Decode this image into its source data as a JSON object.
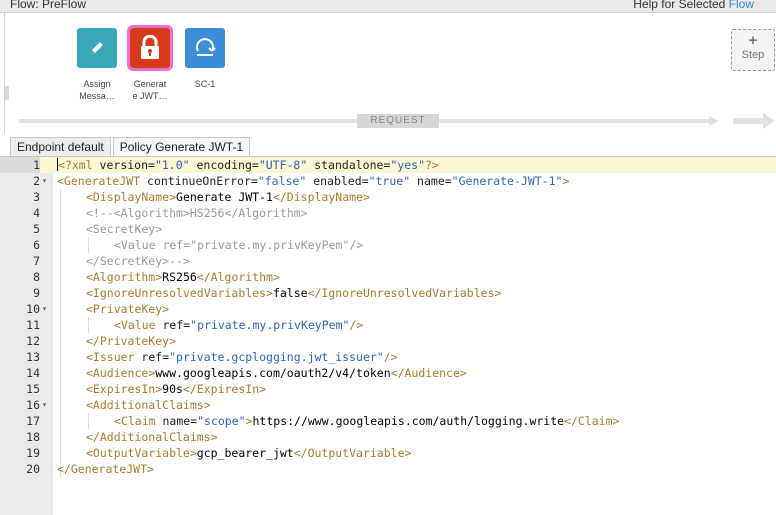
{
  "header": {
    "flow_title": "Flow: PreFlow",
    "help_text": "Help for Selected",
    "help_link": "Flow"
  },
  "policies": [
    {
      "line1": "Assign",
      "line2": "Messa…",
      "icon": "pencil-icon",
      "color": "#36a8b6"
    },
    {
      "line1": "Generat",
      "line2": "e JWT…",
      "icon": "lock-icon",
      "color": "#d83a1d",
      "selected": true
    },
    {
      "line1": "SC-1",
      "line2": "",
      "icon": "refresh-icon",
      "color": "#3a8ed8"
    }
  ],
  "step_button": {
    "plus": "+",
    "label": "Step"
  },
  "flow_label": "REQUEST",
  "tabs": [
    {
      "label": "Endpoint default"
    },
    {
      "label": "Policy Generate JWT-1",
      "active": true
    }
  ],
  "editor": {
    "line_numbers": [
      "1",
      "2",
      "3",
      "4",
      "5",
      "6",
      "7",
      "8",
      "9",
      "10",
      "11",
      "12",
      "13",
      "14",
      "15",
      "16",
      "17",
      "18",
      "19",
      "20"
    ],
    "tokens": {
      "l1": [
        "<?xml",
        " version=",
        "\"1.0\"",
        " encoding=",
        "\"UTF-8\"",
        " standalone=",
        "\"yes\"",
        "?>"
      ],
      "l2": [
        "<GenerateJWT",
        " continueOnError=",
        "\"false\"",
        " enabled=",
        "\"true\"",
        " name=",
        "\"Generate-JWT-1\"",
        ">"
      ],
      "l3": [
        "<DisplayName>",
        "Generate JWT-1",
        "</DisplayName>"
      ],
      "l4": [
        "<!--<Algorithm>HS256</Algorithm>"
      ],
      "l5": [
        "<SecretKey>"
      ],
      "l6": [
        "<Value ref=\"private.my.privKeyPem\"/>"
      ],
      "l7": [
        "</SecretKey>-->"
      ],
      "l8": [
        "<Algorithm>",
        "RS256",
        "</Algorithm>"
      ],
      "l9": [
        "<IgnoreUnresolvedVariables>",
        "false",
        "</IgnoreUnresolvedVariables>"
      ],
      "l10": [
        "<PrivateKey>"
      ],
      "l11": [
        "<Value",
        " ref=",
        "\"private.my.privKeyPem\"",
        "/>"
      ],
      "l12": [
        "</PrivateKey>"
      ],
      "l13": [
        "<Issuer",
        " ref=",
        "\"private.gcplogging.jwt_issuer\"",
        "/>"
      ],
      "l14": [
        "<Audience>",
        "www.googleapis.com/oauth2/v4/token",
        "</Audience>"
      ],
      "l15": [
        "<ExpiresIn>",
        "90s",
        "</ExpiresIn>"
      ],
      "l16": [
        "<AdditionalClaims>"
      ],
      "l17": [
        "<Claim",
        " name=",
        "\"scope\"",
        ">",
        "https://www.googleapis.com/auth/logging.write",
        "</Claim>"
      ],
      "l18": [
        "</AdditionalClaims>"
      ],
      "l19": [
        "<OutputVariable>",
        "gcp_bearer_jwt",
        "</OutputVariable>"
      ],
      "l20": [
        "</GenerateJWT>"
      ]
    }
  }
}
